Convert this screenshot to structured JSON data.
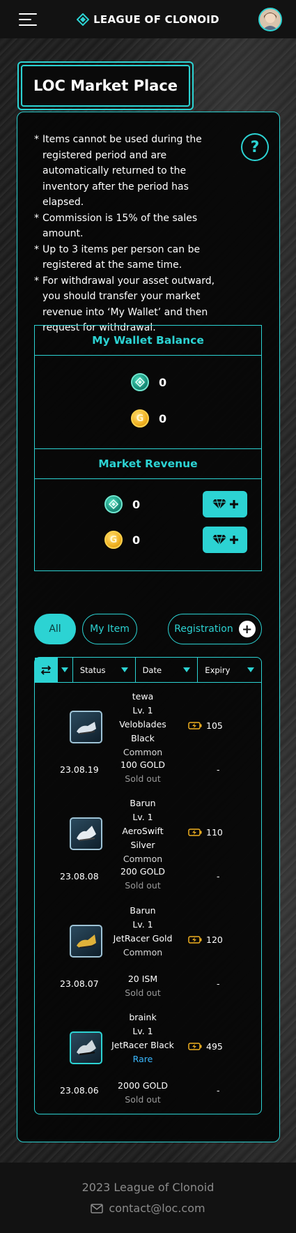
{
  "header": {
    "logo_text": "LEAGUE OF CLONOID"
  },
  "page_title": "LOC Market Place",
  "rules": [
    "Items cannot be used during the registered period and are automatically returned to the inventory after the period has elapsed.",
    "Commission is 15% of the sales amount.",
    "Up to 3 items per person can be registered at the same time.",
    "For withdrawal your asset outward, you should transfer your market revenue into ‘My Wallet’ and then request for withdrawal."
  ],
  "help_label": "?",
  "wallet": {
    "title": "My Wallet Balance",
    "ism_balance": "0",
    "gold_balance": "0"
  },
  "revenue": {
    "title": "Market Revenue",
    "ism_balance": "0",
    "gold_balance": "0"
  },
  "filters": {
    "all": "All",
    "my_item": "My Item",
    "registration": "Registration"
  },
  "table": {
    "columns": [
      "Status",
      "Date",
      "Expiry"
    ],
    "items": [
      {
        "seller": "tewa",
        "level": "Lv. 1",
        "name": "Veloblades Black",
        "grade": "Common",
        "energy": "105",
        "date": "23.08.19",
        "price": "100 GOLD",
        "status": "Sold out",
        "expiry": "-"
      },
      {
        "seller": "Barun",
        "level": "Lv. 1",
        "name": "AeroSwift Silver",
        "grade": "Common",
        "energy": "110",
        "date": "23.08.08",
        "price": "200 GOLD",
        "status": "Sold out",
        "expiry": "-"
      },
      {
        "seller": "Barun",
        "level": "Lv. 1",
        "name": "JetRacer Gold",
        "grade": "Common",
        "energy": "120",
        "date": "23.08.07",
        "price": "20 ISM",
        "status": "Sold out",
        "expiry": "-"
      },
      {
        "seller": "braink",
        "level": "Lv. 1",
        "name": "JetRacer Black",
        "grade": "Rare",
        "energy": "495",
        "date": "23.08.06",
        "price": "2000 GOLD",
        "status": "Sold out",
        "expiry": "-"
      }
    ]
  },
  "footer": {
    "copyright": "2023 League of Clonoid",
    "email": "contact@loc.com"
  },
  "colors": {
    "accent": "#2cd3d3",
    "rare": "#3ab8ff",
    "gold": "#f0b020"
  }
}
